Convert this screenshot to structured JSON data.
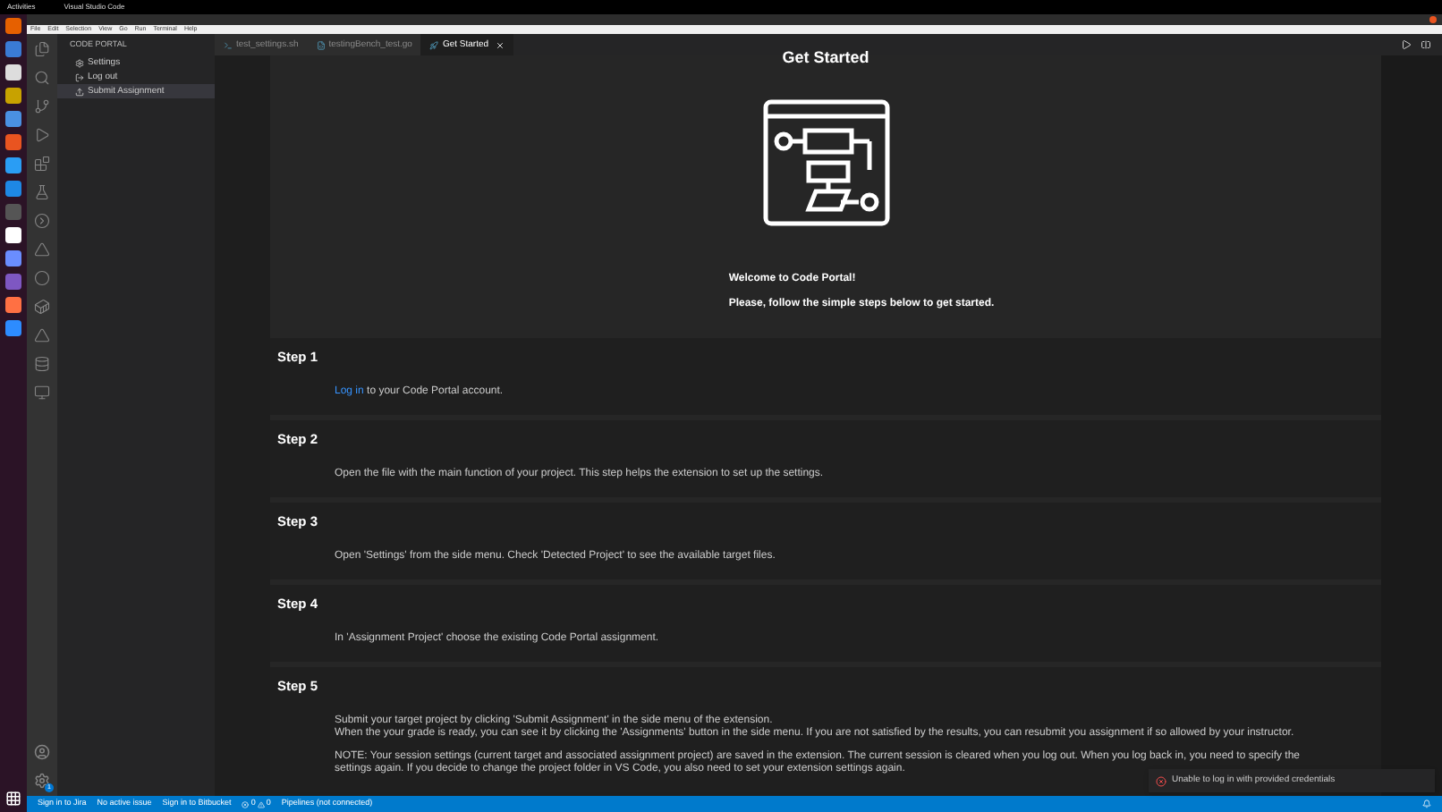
{
  "top_bar": {
    "activities": "Activities",
    "app": "Visual Studio Code"
  },
  "menu": [
    "File",
    "Edit",
    "Selection",
    "View",
    "Go",
    "Run",
    "Terminal",
    "Help"
  ],
  "sidebar": {
    "title": "CODE PORTAL",
    "items": [
      {
        "label": "Settings",
        "kind": "gear",
        "selected": false
      },
      {
        "label": "Log out",
        "kind": "logout",
        "selected": false
      },
      {
        "label": "Submit Assignment",
        "kind": "upload",
        "selected": true
      }
    ]
  },
  "tabs": [
    {
      "label": "test_settings.sh",
      "kind": "shell",
      "selected": false
    },
    {
      "label": "testingBench_test.go",
      "kind": "go",
      "selected": false
    },
    {
      "label": "Get Started",
      "kind": "rocket",
      "selected": true
    }
  ],
  "page": {
    "heading": "Get Started",
    "welcome": "Welcome to Code Portal!",
    "intro": "Please, follow the simple steps below to get started.",
    "steps": [
      {
        "title": "Step 1",
        "paragraphs": [
          {
            "link": "Log in",
            "lines": [
              "to your Code Portal account."
            ]
          }
        ]
      },
      {
        "title": "Step 2",
        "paragraphs": [
          {
            "lines": [
              "Open the file with the main function of your project. This step helps the extension to set up the settings."
            ]
          }
        ]
      },
      {
        "title": "Step 3",
        "paragraphs": [
          {
            "lines": [
              "Open 'Settings' from the side menu. Check 'Detected Project' to see the available target files."
            ]
          }
        ]
      },
      {
        "title": "Step 4",
        "paragraphs": [
          {
            "lines": [
              "In 'Assignment Project' choose the existing Code Portal assignment."
            ]
          }
        ]
      },
      {
        "title": "Step 5",
        "paragraphs": [
          {
            "lines": [
              "Submit your target project by clicking 'Submit Assignment' in the side menu of the extension.",
              "When the your grade is ready, you can see it by clicking the 'Assignments' button in the side menu. If you are not satisfied by the results, you can resubmit you assignment if so allowed by your instructor."
            ]
          },
          {
            "lines": [
              "NOTE: Your session settings (current target and associated assignment project) are saved in the extension. The current session is cleared when you log out. When you log back in, you need to specify the settings again. If you decide to change the project folder in VS Code, you also need to set your extension settings again."
            ]
          }
        ]
      }
    ]
  },
  "notification": {
    "kind": "error",
    "text": "Unable to log in with provided credentials"
  },
  "settings_badge": "1",
  "status_bar": {
    "items": [
      "Sign in to Jira",
      "No active issue",
      "Sign in to Bitbucket"
    ],
    "errors": "0",
    "warnings": "0",
    "pipelines": "Pipelines (not connected)"
  }
}
